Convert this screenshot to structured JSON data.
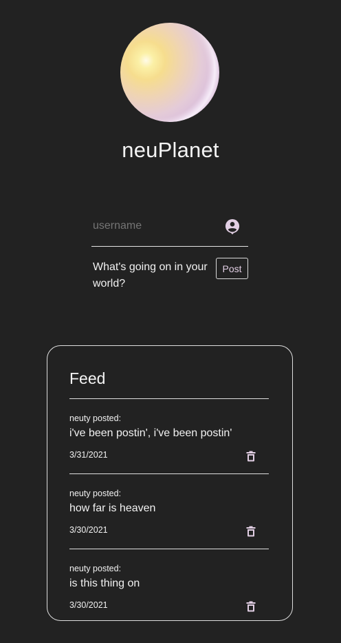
{
  "app": {
    "title": "neuPlanet"
  },
  "compose": {
    "username_placeholder": "username",
    "prompt": "What's going on in your world?",
    "post_label": "Post",
    "user_icon": "account-circle-icon"
  },
  "feed": {
    "title": "Feed",
    "posts": [
      {
        "author_line": "neuty posted:",
        "text": "i've been postin', i've been postin'",
        "date": "3/31/2021",
        "delete_icon": "trash-icon"
      },
      {
        "author_line": "neuty posted:",
        "text": "how far is heaven",
        "date": "3/30/2021",
        "delete_icon": "trash-icon"
      },
      {
        "author_line": "neuty posted:",
        "text": "is this thing on",
        "date": "3/30/2021",
        "delete_icon": "trash-icon"
      }
    ]
  },
  "colors": {
    "background": "#222222",
    "accent": "#e2cfe4",
    "text": "#f2f2f2"
  }
}
